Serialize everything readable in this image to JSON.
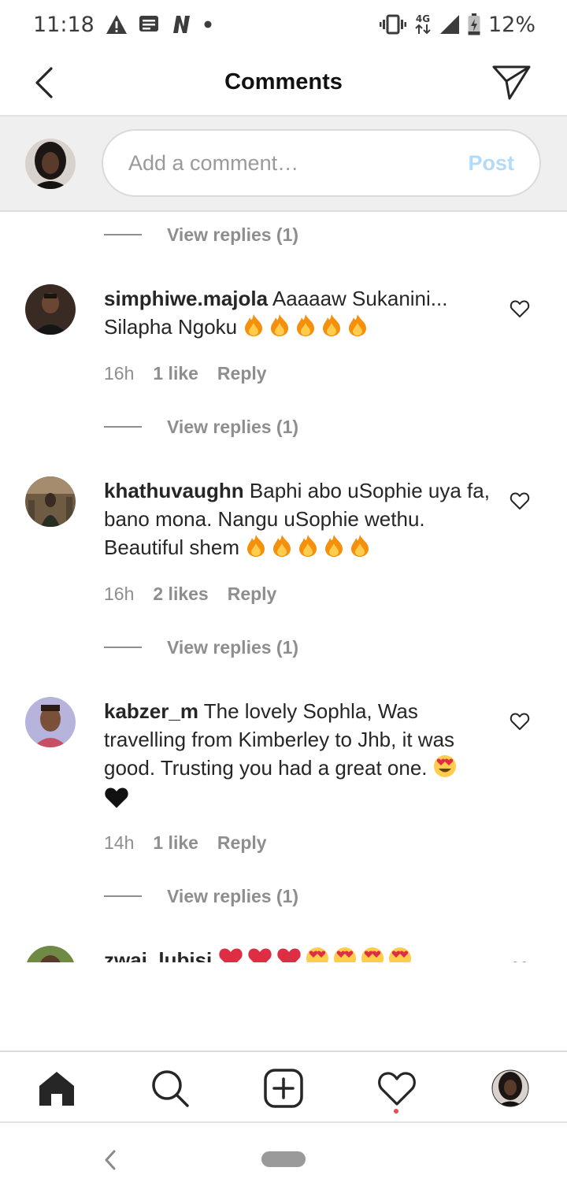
{
  "status_bar": {
    "time": "11:18",
    "network": "4G",
    "battery": "12%",
    "left_icons": [
      "warning-icon",
      "message-icon",
      "netflix-icon",
      "dot-icon"
    ],
    "right_icons": [
      "vibrate-icon",
      "network-4g-icon",
      "signal-icon",
      "battery-charging-icon"
    ]
  },
  "header": {
    "title": "Comments",
    "back_icon": "chevron-left-icon",
    "send_icon": "paper-plane-icon"
  },
  "composer": {
    "placeholder": "Add a comment…",
    "post_label": "Post"
  },
  "comments": [
    {
      "view_replies_above": "View replies (1)",
      "username": "simphiwe.majola",
      "text": "Aaaaaw Sukanini... Silapha Ngoku",
      "emojis": [
        "fire",
        "fire",
        "fire",
        "fire",
        "fire"
      ],
      "time": "16h",
      "likes": "1 like",
      "reply": "Reply",
      "view_replies": "View replies (1)"
    },
    {
      "username": "khathuvaughn",
      "text": "Baphi abo uSophie uya fa, bano mona. Nangu uSophie wethu. Beautiful shem",
      "emojis": [
        "fire",
        "fire",
        "fire",
        "fire",
        "fire"
      ],
      "time": "16h",
      "likes": "2 likes",
      "reply": "Reply",
      "view_replies": "View replies (1)"
    },
    {
      "username": "kabzer_m",
      "text": "The lovely Sophla, Was travelling from Kimberley to Jhb, it was good. Trusting you had a great one.",
      "emojis": [
        "heart-eyes",
        "black-heart"
      ],
      "time": "14h",
      "likes": "1 like",
      "reply": "Reply",
      "view_replies": "View replies (1)"
    },
    {
      "username": "zwai_lubisi",
      "text": "",
      "emojis": [
        "red-heart",
        "red-heart",
        "red-heart",
        "heart-eyes",
        "heart-eyes",
        "heart-eyes",
        "heart-eyes"
      ]
    }
  ],
  "bottom_nav": {
    "items": [
      "home-icon",
      "search-icon",
      "new-post-icon",
      "activity-heart-icon",
      "profile-avatar"
    ]
  },
  "colors": {
    "post_disabled": "#b3dbf9",
    "meta_gray": "#8e8e8e",
    "notification_dot": "#ed4956"
  }
}
